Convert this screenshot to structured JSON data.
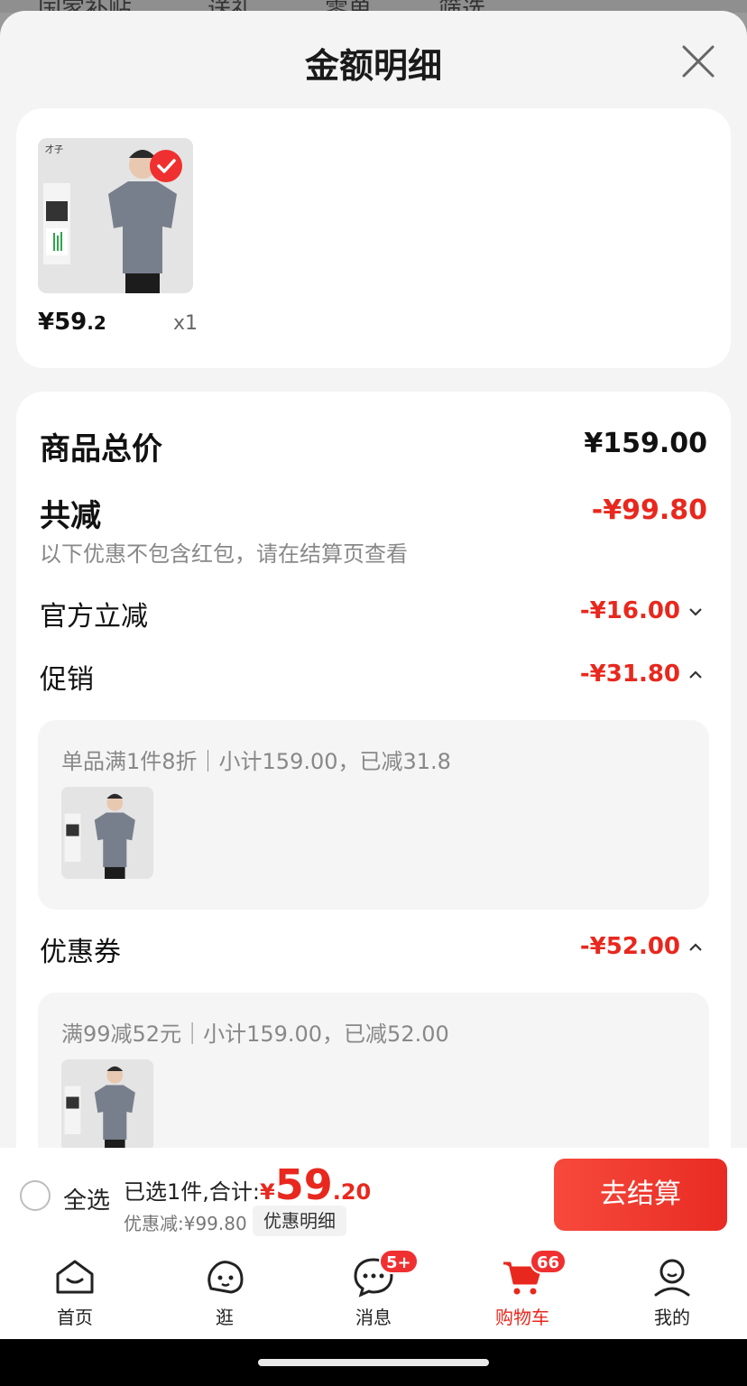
{
  "background_tabs": [
    "国家补贴",
    "送礼",
    "零单",
    "筛选"
  ],
  "sheet": {
    "title": "金额明细"
  },
  "item": {
    "price_main": "¥59",
    "price_decimal": ".2",
    "quantity": "x1",
    "selected": true
  },
  "summary": {
    "total_label": "商品总价",
    "total_value": "¥159.00",
    "reduce_label": "共减",
    "reduce_value": "-¥99.80",
    "reduce_note": "以下优惠不包含红包，请在结算页查看"
  },
  "official": {
    "label": "官方立减",
    "value": "-¥16.00"
  },
  "promotion": {
    "label": "促销",
    "value": "-¥31.80",
    "detail": "单品满1件8折｜小计159.00，已减31.8"
  },
  "coupon": {
    "label": "优惠券",
    "value": "-¥52.00",
    "detail": "满99减52元｜小计159.00，已减52.00"
  },
  "checkout": {
    "select_all": "全选",
    "selected_text": "已选1件,合计:",
    "currency": "¥",
    "total_int": "59",
    "total_dec": ".20",
    "discount_text": "优惠减:¥99.80",
    "detail_chip": "优惠明细",
    "button": "去结算"
  },
  "tabbar": {
    "items": [
      {
        "label": "首页",
        "icon": "home-icon"
      },
      {
        "label": "逛",
        "icon": "explore-icon"
      },
      {
        "label": "消息",
        "icon": "message-icon",
        "badge": "5+"
      },
      {
        "label": "购物车",
        "icon": "cart-icon",
        "badge": "66",
        "active": true
      },
      {
        "label": "我的",
        "icon": "profile-icon"
      }
    ]
  },
  "colors": {
    "accent_red": "#e8281e",
    "sheet_bg": "#f4f4f4",
    "card_bg": "#ffffff"
  }
}
